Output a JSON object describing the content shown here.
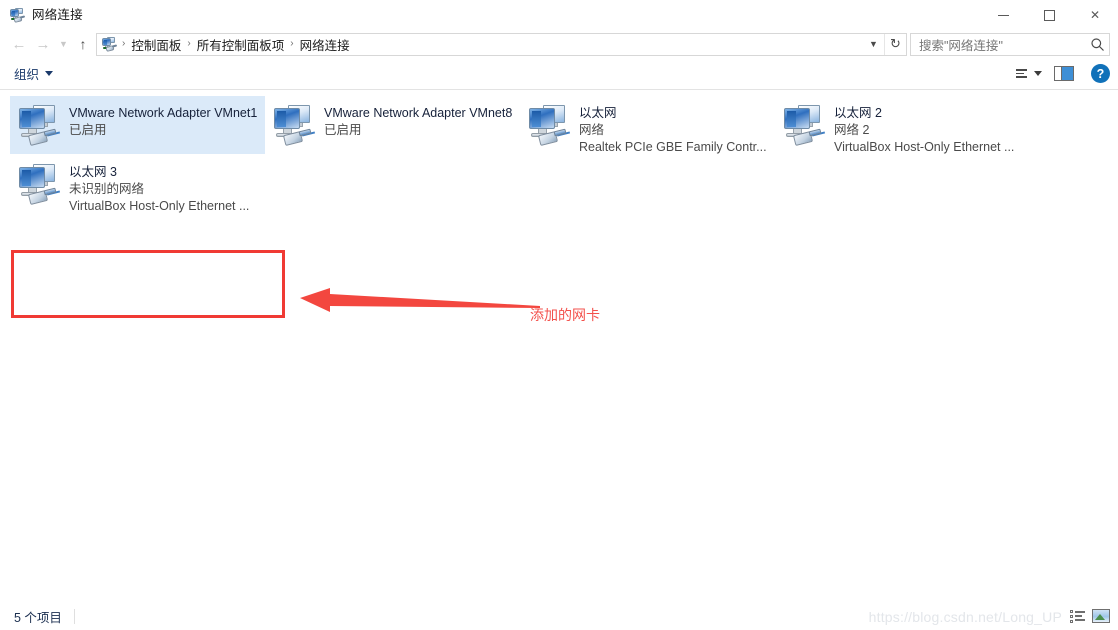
{
  "window": {
    "title": "网络连接",
    "app_icon": "network-connection-icon",
    "minimize_label": "最小化",
    "maximize_label": "最大化",
    "close_label": "关闭"
  },
  "navbar": {
    "back_icon": "back-arrow-icon",
    "forward_icon": "forward-arrow-icon",
    "recent_icon": "chevron-down-icon",
    "up_icon": "up-arrow-icon",
    "address_icon": "network-connection-icon",
    "breadcrumbs": [
      "控制面板",
      "所有控制面板项",
      "网络连接"
    ],
    "separator": "›",
    "dropdown_icon": "chevron-down-icon",
    "refresh_icon": "refresh-icon"
  },
  "search": {
    "placeholder": "搜索\"网络连接\"",
    "icon": "search-icon"
  },
  "toolbar": {
    "organize_label": "组织",
    "organize_caret": "caret-down-icon",
    "view_options_icon": "view-options-icon",
    "view_options_caret": "caret-down-icon",
    "preview_pane_icon": "preview-pane-icon",
    "help_icon": "help-icon",
    "help_glyph": "?"
  },
  "connections": [
    {
      "name": "VMware Network Adapter VMnet1",
      "status": "已启用",
      "device": "",
      "selected": true,
      "icon": "network-adapter-icon"
    },
    {
      "name": "VMware Network Adapter VMnet8",
      "status": "已启用",
      "device": "",
      "selected": false,
      "icon": "network-adapter-icon"
    },
    {
      "name": "以太网",
      "status": "网络",
      "device": "Realtek PCIe GBE Family Contr...",
      "selected": false,
      "icon": "network-adapter-icon"
    },
    {
      "name": "以太网 2",
      "status": "网络 2",
      "device": "VirtualBox Host-Only Ethernet ...",
      "selected": false,
      "icon": "network-adapter-icon"
    },
    {
      "name": "以太网 3",
      "status": "未识别的网络",
      "device": "VirtualBox Host-Only Ethernet ...",
      "selected": false,
      "icon": "network-adapter-icon"
    }
  ],
  "annotation": {
    "text": "添加的网卡",
    "color": "#f3514c",
    "box_color": "#f03a34",
    "arrow_icon": "left-arrow-annotation"
  },
  "statusbar": {
    "item_count": "5 个项目",
    "details_view_icon": "details-view-icon",
    "tiles_view_icon": "tiles-view-icon",
    "watermark": "https://blog.csdn.net/Long_UP"
  },
  "colors": {
    "selection": "#dbeaf9",
    "accent": "#1071b9",
    "annotation_red": "#f03a34",
    "link_blue": "#1b3a6b"
  }
}
